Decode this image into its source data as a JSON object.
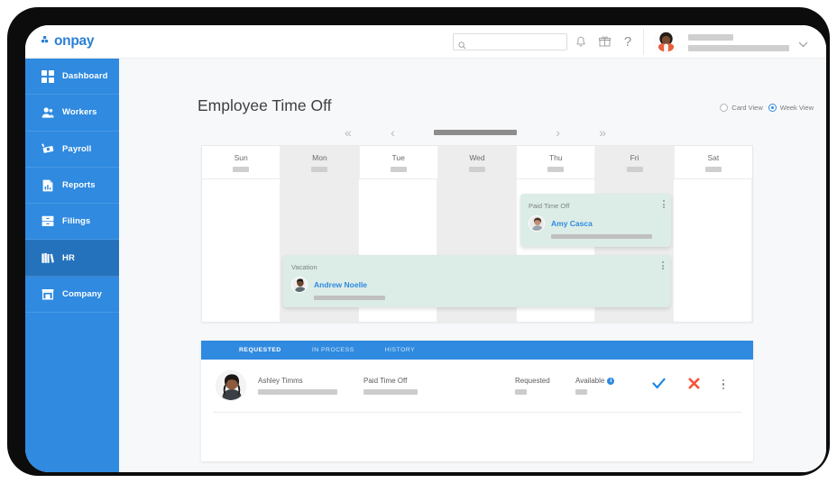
{
  "brand": {
    "name": "onpay",
    "primary_color": "#2f8ae0",
    "active_nav_color": "#2572bc"
  },
  "topbar": {
    "search": {
      "value": "",
      "placeholder": ""
    },
    "icons": [
      {
        "name": "bell-icon",
        "label": "Notifications"
      },
      {
        "name": "gift-icon",
        "label": "Rewards"
      },
      {
        "name": "help-icon",
        "label": "?"
      }
    ],
    "help_glyph": "?",
    "user": {
      "name_redacted": true,
      "company_redacted": true
    },
    "chevron": "▾"
  },
  "sidebar": {
    "items": [
      {
        "label": "Dashboard",
        "icon": "grid-icon",
        "active": false
      },
      {
        "label": "Workers",
        "icon": "people-icon",
        "active": false
      },
      {
        "label": "Payroll",
        "icon": "payroll-icon",
        "active": false
      },
      {
        "label": "Reports",
        "icon": "report-icon",
        "active": false
      },
      {
        "label": "Filings",
        "icon": "filing-cabinet-icon",
        "active": false
      },
      {
        "label": "HR",
        "icon": "books-icon",
        "active": true
      },
      {
        "label": "Company",
        "icon": "store-icon",
        "active": false
      }
    ]
  },
  "page": {
    "title": "Employee Time Off"
  },
  "view_toggle": {
    "options": [
      {
        "label": "Card View",
        "selected": false
      },
      {
        "label": "Week View",
        "selected": true
      }
    ]
  },
  "week_nav": {
    "first": "«",
    "prev": "‹",
    "next": "›",
    "last": "»",
    "label_redacted": true
  },
  "calendar": {
    "days": [
      {
        "name": "Sun",
        "shaded": false
      },
      {
        "name": "Mon",
        "shaded": true
      },
      {
        "name": "Tue",
        "shaded": false
      },
      {
        "name": "Wed",
        "shaded": true
      },
      {
        "name": "Thu",
        "shaded": false
      },
      {
        "name": "Fri",
        "shaded": true
      },
      {
        "name": "Sat",
        "shaded": false
      }
    ],
    "events": [
      {
        "type": "Paid Time Off",
        "employee": "Amy Casca",
        "span_days": "Thu-Fri",
        "color": "#dcece6"
      },
      {
        "type": "Vacation",
        "employee": "Andrew Noelle",
        "span_days": "Mon-Fri",
        "color": "#dcece6"
      }
    ]
  },
  "requests": {
    "tabs": [
      {
        "label": "REQUESTED",
        "active": true
      },
      {
        "label": "IN PROCESS",
        "active": false
      },
      {
        "label": "HISTORY",
        "active": false
      }
    ],
    "columns": {
      "requested": "Requested",
      "available": "Available"
    },
    "rows": [
      {
        "employee": "Ashley Timms",
        "type": "Paid Time Off",
        "requested_label": "Requested",
        "available_label": "Available",
        "approve_icon": "check-icon",
        "deny_icon": "x-icon",
        "more_icon": "kebab-menu-icon"
      }
    ]
  },
  "colors": {
    "approve": "#1e88e5",
    "deny": "#f4553c",
    "event_card": "#dcece6",
    "page_background": "#f7f8fa"
  }
}
